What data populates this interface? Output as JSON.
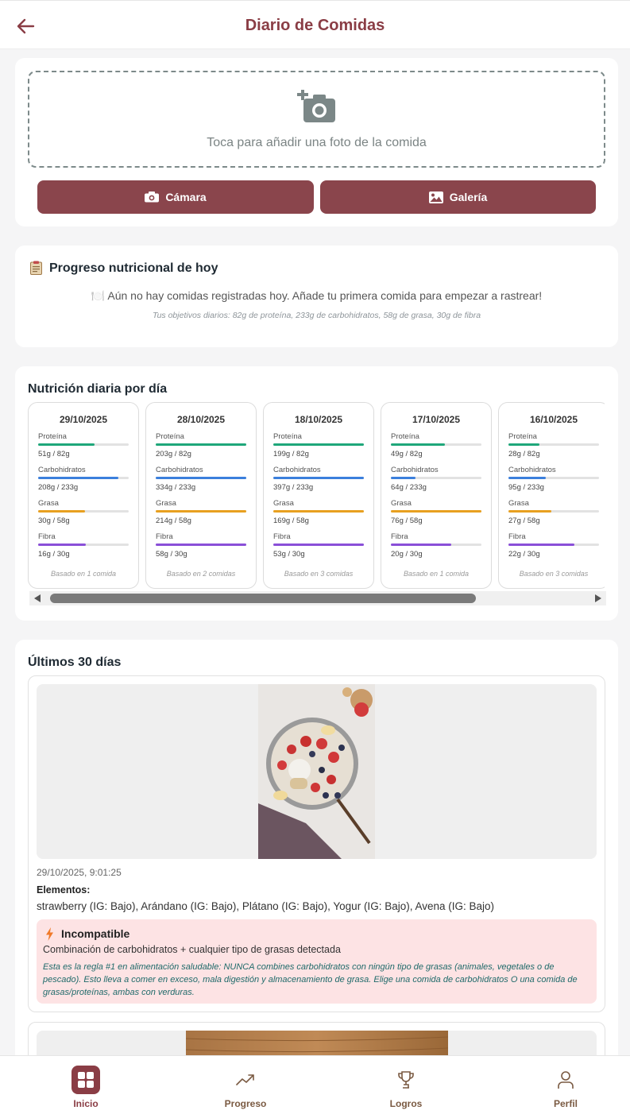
{
  "header": {
    "title": "Diario de Comidas",
    "back_icon": "arrow-left-icon"
  },
  "upload": {
    "prompt": "Toca para añadir una foto de la comida",
    "icon": "add-photo-icon",
    "camera_label": "Cámara",
    "gallery_label": "Galería",
    "camera_icon": "camera-icon",
    "gallery_icon": "image-icon"
  },
  "today_progress": {
    "icon": "clipboard-icon",
    "title": "Progreso nutricional de hoy",
    "empty_message": "🍽️ Aún no hay comidas registradas hoy. Añade tu primera comida para empezar a rastrear!",
    "goals": "Tus objetivos diarios: 82g de proteína, 233g de carbohidratos, 58g de grasa, 30g de fibra"
  },
  "daily": {
    "title": "Nutrición diaria por día",
    "labels": {
      "protein": "Proteína",
      "carbs": "Carbohidratos",
      "fat": "Grasa",
      "fiber": "Fibra"
    },
    "colors": {
      "protein": "#1fa77a",
      "carbs": "#3b7fdc",
      "fat": "#e8a020",
      "fiber": "#8a4fd8"
    },
    "days": [
      {
        "date": "29/10/2025",
        "protein": "51g / 82g",
        "protein_pct": 0.62,
        "carbs": "208g / 233g",
        "carbs_pct": 0.89,
        "fat": "30g / 58g",
        "fat_pct": 0.52,
        "fiber": "16g / 30g",
        "fiber_pct": 0.53,
        "footer": "Basado en 1 comida"
      },
      {
        "date": "28/10/2025",
        "protein": "203g / 82g",
        "protein_pct": 1.0,
        "carbs": "334g / 233g",
        "carbs_pct": 1.0,
        "fat": "214g / 58g",
        "fat_pct": 1.0,
        "fiber": "58g / 30g",
        "fiber_pct": 1.0,
        "footer": "Basado en 2 comidas"
      },
      {
        "date": "18/10/2025",
        "protein": "199g / 82g",
        "protein_pct": 1.0,
        "carbs": "397g / 233g",
        "carbs_pct": 1.0,
        "fat": "169g / 58g",
        "fat_pct": 1.0,
        "fiber": "53g / 30g",
        "fiber_pct": 1.0,
        "footer": "Basado en 3 comidas"
      },
      {
        "date": "17/10/2025",
        "protein": "49g / 82g",
        "protein_pct": 0.6,
        "carbs": "64g / 233g",
        "carbs_pct": 0.27,
        "fat": "76g / 58g",
        "fat_pct": 1.0,
        "fiber": "20g / 30g",
        "fiber_pct": 0.67,
        "footer": "Basado en 1 comida"
      },
      {
        "date": "16/10/2025",
        "protein": "28g / 82g",
        "protein_pct": 0.34,
        "carbs": "95g / 233g",
        "carbs_pct": 0.41,
        "fat": "27g / 58g",
        "fat_pct": 0.47,
        "fiber": "22g / 30g",
        "fiber_pct": 0.73,
        "footer": "Basado en 3 comidas"
      }
    ]
  },
  "history": {
    "title": "Últimos 30 días",
    "meals": [
      {
        "datetime": "29/10/2025, 9:01:25",
        "elements_label": "Elementos:",
        "elements": "strawberry (IG: Bajo), Arándano (IG: Bajo), Plátano (IG: Bajo), Yogur (IG: Bajo), Avena (IG: Bajo)",
        "alert": {
          "icon": "lightning-icon",
          "title": "Incompatible",
          "subtitle": "Combinación de carbohidratos + cualquier tipo de grasas detectada",
          "body": "Esta es la regla #1 en alimentación saludable: NUNCA combines carbohidratos con ningún tipo de grasas (animales, vegetales o de pescado). Esto lleva a comer en exceso, mala digestión y almacenamiento de grasa. Elige una comida de carbohidratos O una comida de grasas/proteínas, ambas con verduras."
        }
      }
    ]
  },
  "nav": [
    {
      "label": "Inicio",
      "icon": "grid-icon",
      "active": true
    },
    {
      "label": "Progreso",
      "icon": "trending-up-icon",
      "active": false
    },
    {
      "label": "Logros",
      "icon": "trophy-icon",
      "active": false
    },
    {
      "label": "Perfil",
      "icon": "user-icon",
      "active": false
    }
  ],
  "colors": {
    "brand": "#8a3d45",
    "button": "#8a454c",
    "alert_bg": "#fde3e4"
  }
}
